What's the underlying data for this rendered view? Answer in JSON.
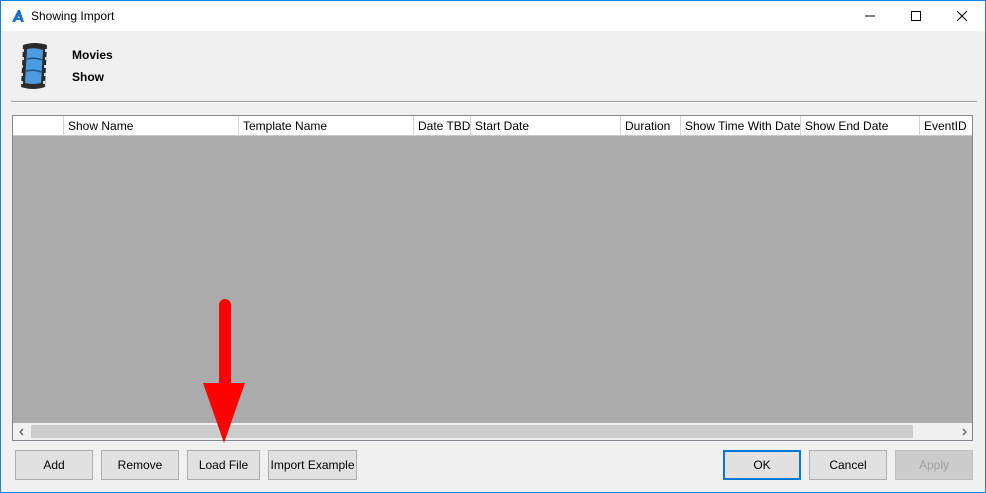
{
  "window": {
    "title": "Showing Import"
  },
  "header": {
    "title": "Movies",
    "subtitle": "Show"
  },
  "grid": {
    "columns": [
      "",
      "Show Name",
      "Template Name",
      "Date TBD",
      "Start Date",
      "Duration",
      "Show Time With Date",
      "Show End Date",
      "EventID"
    ],
    "rows": []
  },
  "buttons": {
    "add": "Add",
    "remove": "Remove",
    "load_file": "Load File",
    "import_example": "Import Example",
    "ok": "OK",
    "cancel": "Cancel",
    "apply": "Apply"
  },
  "colors": {
    "accent": "#0078d7",
    "grid_background": "#ababab",
    "annotation_arrow": "#ff0000"
  }
}
